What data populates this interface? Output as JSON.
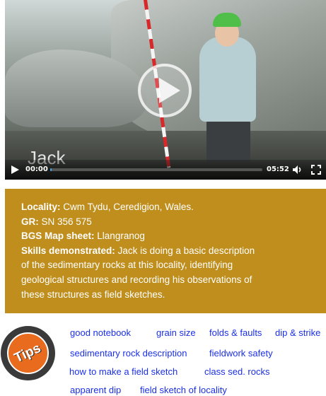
{
  "video": {
    "caption": "Jack",
    "current_time": "00:00",
    "duration": "05:52",
    "progress_fraction": 0.0
  },
  "info": {
    "locality_label": "Locality:",
    "locality_value": "Cwm Tydu, Ceredigion, Wales.",
    "gr_label": "GR:",
    "gr_value": "SN 356 575",
    "bgs_label": "BGS Map sheet:",
    "bgs_value": "Llangranog",
    "skills_label": "Skills demonstrated:",
    "skills_value": "Jack is doing a basic description of the sedimentary rocks at this locality, identifying geological structures and recording his observations of these structures as field sketches."
  },
  "tips": {
    "badge": "Tips",
    "links": [
      "good notebook",
      "grain size",
      "folds & faults",
      "dip & strike",
      "sedimentary rock description",
      "fieldwork safety",
      "how to make a field sketch",
      "class sed. rocks",
      "apparent dip",
      "field sketch of locality"
    ]
  },
  "colors": {
    "info_background": "#bf8e1d",
    "link": "#1a2fe8",
    "progress": "#3fa9f5",
    "tips_badge": "#e96b1d"
  },
  "icons": [
    "play-icon",
    "volume-icon",
    "fullscreen-icon"
  ]
}
